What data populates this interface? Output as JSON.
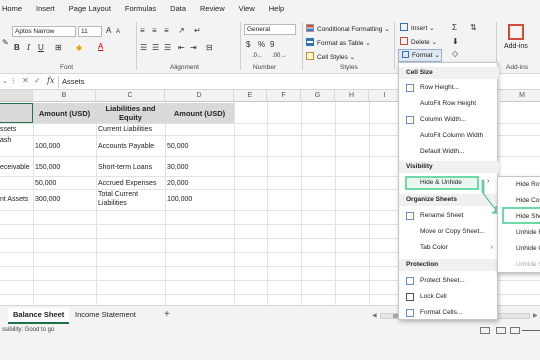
{
  "ribbon_tabs": [
    "Home",
    "Insert",
    "Page Layout",
    "Formulas",
    "Data",
    "Review",
    "View",
    "Help"
  ],
  "font": {
    "name": "Aptos Narrow",
    "size": "11"
  },
  "number_format": "General",
  "styles": {
    "conditional_formatting": "Conditional Formatting",
    "format_as_table": "Format as Table",
    "cell_styles": "Cell Styles"
  },
  "cells_group": {
    "insert": "Insert",
    "delete": "Delete",
    "format": "Format"
  },
  "addins": "Add-ins",
  "group_labels": {
    "font": "Font",
    "alignment": "Alignment",
    "number": "Number",
    "styles": "Styles",
    "addins": "Add-ins"
  },
  "formula_bar": {
    "fx": "fx",
    "value": "Assets"
  },
  "columns": [
    "B",
    "C",
    "D",
    "E",
    "F",
    "G",
    "H",
    "I",
    "M"
  ],
  "table": {
    "headers": [
      "Amount (USD)",
      "Liabilities and Equity",
      "Amount (USD)"
    ],
    "rows": [
      {
        "a": "ssets",
        "b": "",
        "c": "Current Liabilities",
        "d": ""
      },
      {
        "a": "ash",
        "b": "100,000",
        "c": "Accounts Payable",
        "d": "50,000"
      },
      {
        "a": "eceivable",
        "b": "150,000",
        "c": "Short-term Loans",
        "d": "30,000"
      },
      {
        "a": "",
        "b": "50,000",
        "c": "Accrued Expenses",
        "d": "20,000"
      },
      {
        "a": "nt Assets",
        "b": "300,000",
        "c": "Total Current Liabilities",
        "d": "100,000"
      }
    ]
  },
  "sheets": {
    "active": "Balance Sheet",
    "other": "Income Statement",
    "add": "+"
  },
  "status": "ssibility: Good to go",
  "menu": {
    "cell_size_head": "Cell Size",
    "row_height": "Row Height...",
    "autofit_row": "AutoFit Row Height",
    "column_width": "Column Width...",
    "autofit_col": "AutoFit Column Width",
    "default_width": "Default Width...",
    "visibility_head": "Visibility",
    "hide_unhide": "Hide & Unhide",
    "organize_head": "Organize Sheets",
    "rename_sheet": "Rename Sheet",
    "move_copy": "Move or Copy Sheet...",
    "tab_color": "Tab Color",
    "protection_head": "Protection",
    "protect_sheet": "Protect Sheet...",
    "lock_cell": "Lock Cell",
    "format_cells": "Format Cells..."
  },
  "submenu": [
    "Hide Rov",
    "Hide Col",
    "Hide She",
    "Unhide R",
    "Unhide C",
    "Unhide S"
  ]
}
